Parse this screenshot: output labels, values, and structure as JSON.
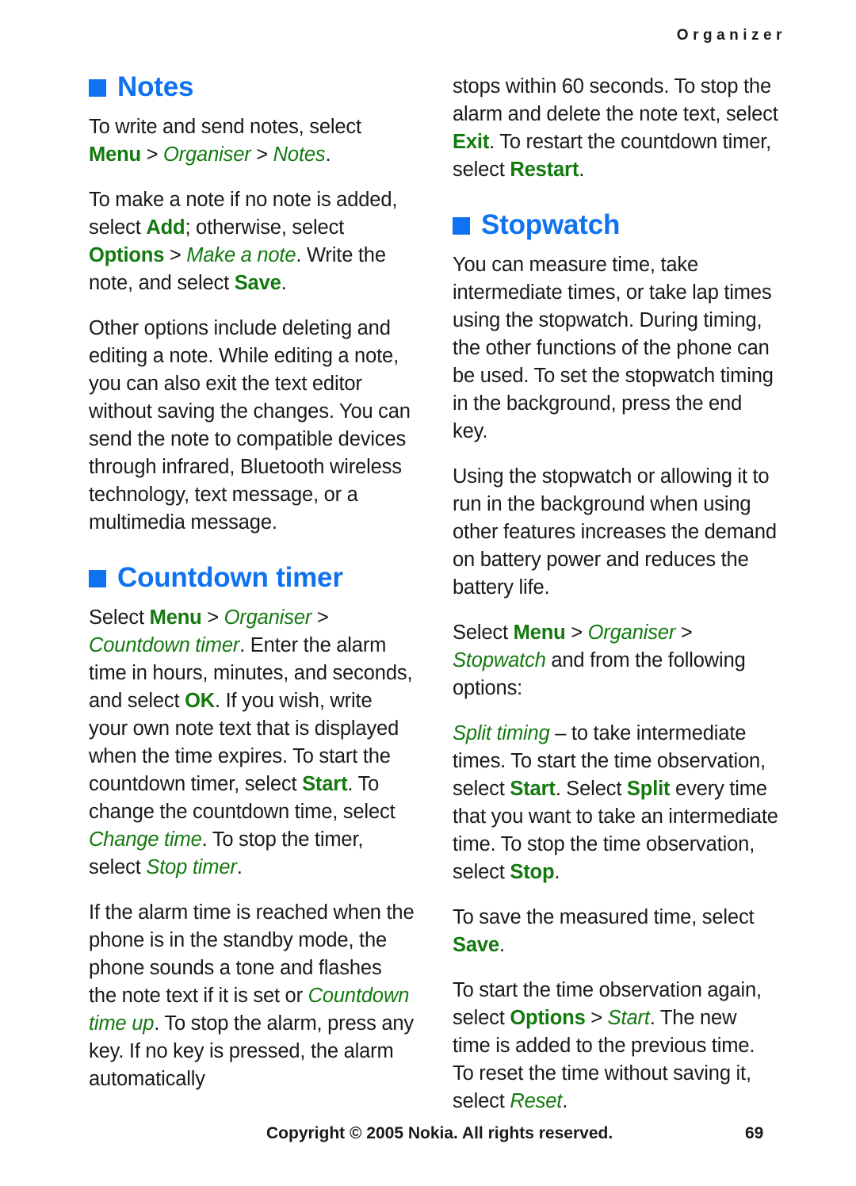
{
  "header": {
    "running_head": "Organizer"
  },
  "left_column": {
    "notes_section": {
      "heading": "Notes",
      "bullet_icon": "blue-square-bullet",
      "paragraphs": [
        {
          "id": "notes-p1",
          "runs": [
            {
              "text": "To write and send notes, select ",
              "style": "plain"
            },
            {
              "text": "Menu",
              "style": "ui-bold"
            },
            {
              "text": " > ",
              "style": "sep"
            },
            {
              "text": "Organiser",
              "style": "ui-italic"
            },
            {
              "text": " > ",
              "style": "sep"
            },
            {
              "text": "Notes",
              "style": "ui-italic"
            },
            {
              "text": ".",
              "style": "plain"
            }
          ]
        },
        {
          "id": "notes-p2",
          "runs": [
            {
              "text": "To make a note if no note is added, select ",
              "style": "plain"
            },
            {
              "text": "Add",
              "style": "ui-bold"
            },
            {
              "text": "; otherwise, select ",
              "style": "plain"
            },
            {
              "text": "Options",
              "style": "ui-bold"
            },
            {
              "text": " > ",
              "style": "sep"
            },
            {
              "text": "Make a note",
              "style": "ui-italic"
            },
            {
              "text": ". Write the note, and select ",
              "style": "plain"
            },
            {
              "text": "Save",
              "style": "ui-bold"
            },
            {
              "text": ".",
              "style": "plain"
            }
          ]
        },
        {
          "id": "notes-p3",
          "runs": [
            {
              "text": "Other options include deleting and editing a note. While editing a note, you can also exit the text editor without saving the changes. You can send the note to compatible devices through infrared, Bluetooth wireless technology, text message, or a multimedia message.",
              "style": "plain"
            }
          ]
        }
      ]
    },
    "countdown_section": {
      "heading": "Countdown timer",
      "bullet_icon": "blue-square-bullet",
      "paragraphs": [
        {
          "id": "countdown-p1",
          "runs": [
            {
              "text": "Select ",
              "style": "plain"
            },
            {
              "text": "Menu",
              "style": "ui-bold"
            },
            {
              "text": " > ",
              "style": "sep"
            },
            {
              "text": "Organiser",
              "style": "ui-italic"
            },
            {
              "text": " > ",
              "style": "sep"
            },
            {
              "text": "Countdown timer",
              "style": "ui-italic"
            },
            {
              "text": ". Enter the alarm time in hours, minutes, and seconds, and select ",
              "style": "plain"
            },
            {
              "text": "OK",
              "style": "ui-bold"
            },
            {
              "text": ". If you wish, write your own note text that is displayed when the time expires. To start the countdown timer, select ",
              "style": "plain"
            },
            {
              "text": "Start",
              "style": "ui-bold"
            },
            {
              "text": ". To change the countdown time, select ",
              "style": "plain"
            },
            {
              "text": "Change time",
              "style": "ui-italic"
            },
            {
              "text": ". To stop the timer, select ",
              "style": "plain"
            },
            {
              "text": "Stop timer",
              "style": "ui-italic"
            },
            {
              "text": ".",
              "style": "plain"
            }
          ]
        },
        {
          "id": "countdown-p2",
          "runs": [
            {
              "text": "If the alarm time is reached when the phone is in the standby mode, the phone sounds a tone and flashes the note text if it is set or ",
              "style": "plain"
            },
            {
              "text": "Countdown time up",
              "style": "ui-italic"
            },
            {
              "text": ". To stop the alarm, press any key. If no key is pressed, the alarm automatically",
              "style": "plain"
            }
          ]
        }
      ]
    }
  },
  "right_column": {
    "countdown_continued": {
      "paragraphs": [
        {
          "id": "countdown-cont-p1",
          "runs": [
            {
              "text": "stops within 60 seconds. To stop the alarm and delete the note text, select ",
              "style": "plain"
            },
            {
              "text": "Exit",
              "style": "ui-bold"
            },
            {
              "text": ". To restart the countdown timer, select ",
              "style": "plain"
            },
            {
              "text": "Restart",
              "style": "ui-bold"
            },
            {
              "text": ".",
              "style": "plain"
            }
          ]
        }
      ]
    },
    "stopwatch_section": {
      "heading": "Stopwatch",
      "bullet_icon": "blue-square-bullet",
      "paragraphs": [
        {
          "id": "stopwatch-p1",
          "runs": [
            {
              "text": "You can measure time, take intermediate times, or take lap times using the stopwatch. During timing, the other functions of the phone can be used. To set the stopwatch timing in the background, press the end key.",
              "style": "plain"
            }
          ]
        },
        {
          "id": "stopwatch-p2",
          "runs": [
            {
              "text": "Using the stopwatch or allowing it to run in the background when using other features increases the demand on battery power and reduces the battery life.",
              "style": "plain"
            }
          ]
        },
        {
          "id": "stopwatch-p3",
          "runs": [
            {
              "text": "Select ",
              "style": "plain"
            },
            {
              "text": "Menu",
              "style": "ui-bold"
            },
            {
              "text": " > ",
              "style": "sep"
            },
            {
              "text": "Organiser",
              "style": "ui-italic"
            },
            {
              "text": " > ",
              "style": "sep"
            },
            {
              "text": "Stopwatch",
              "style": "ui-italic"
            },
            {
              "text": " and from the following options:",
              "style": "plain"
            }
          ]
        },
        {
          "id": "stopwatch-p4",
          "runs": [
            {
              "text": "Split timing",
              "style": "ui-italic"
            },
            {
              "text": " – to take intermediate times. To start the time observation, select ",
              "style": "plain"
            },
            {
              "text": "Start",
              "style": "ui-bold"
            },
            {
              "text": ". Select ",
              "style": "plain"
            },
            {
              "text": "Split",
              "style": "ui-bold"
            },
            {
              "text": " every time that you want to take an intermediate time. To stop the time observation, select ",
              "style": "plain"
            },
            {
              "text": "Stop",
              "style": "ui-bold"
            },
            {
              "text": ".",
              "style": "plain"
            }
          ]
        },
        {
          "id": "stopwatch-p5",
          "runs": [
            {
              "text": "To save the measured time, select ",
              "style": "plain"
            },
            {
              "text": "Save",
              "style": "ui-bold"
            },
            {
              "text": ".",
              "style": "plain"
            }
          ]
        },
        {
          "id": "stopwatch-p6",
          "runs": [
            {
              "text": "To start the time observation again, select ",
              "style": "plain"
            },
            {
              "text": "Options",
              "style": "ui-bold"
            },
            {
              "text": " > ",
              "style": "sep"
            },
            {
              "text": "Start",
              "style": "ui-italic"
            },
            {
              "text": ". The new time is added to the previous time. To reset the time without saving it, select ",
              "style": "plain"
            },
            {
              "text": "Reset",
              "style": "ui-italic"
            },
            {
              "text": ".",
              "style": "plain"
            }
          ]
        }
      ]
    }
  },
  "footer": {
    "copyright": "Copyright © 2005 Nokia. All rights reserved.",
    "page_number": "69"
  },
  "colors": {
    "heading_blue": "#0f72f0",
    "ui_green": "#13790f",
    "body_text": "#1a1a1a",
    "page_background": "#ffffff"
  }
}
